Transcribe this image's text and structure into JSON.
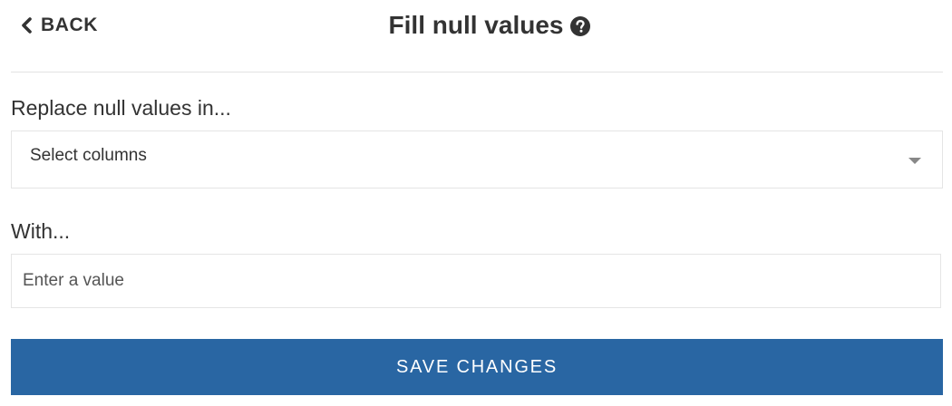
{
  "header": {
    "back_label": "BACK",
    "title": "Fill null values",
    "help_icon": "question-circle-icon"
  },
  "form": {
    "columns_label": "Replace null values in...",
    "columns_select": {
      "selected_value": "Select columns",
      "icon": "caret-down-icon"
    },
    "with_label": "With...",
    "value_input": {
      "value": "",
      "placeholder": "Enter a value"
    }
  },
  "save_button": {
    "label": "SAVE CHANGES",
    "color": "#2966a3"
  }
}
